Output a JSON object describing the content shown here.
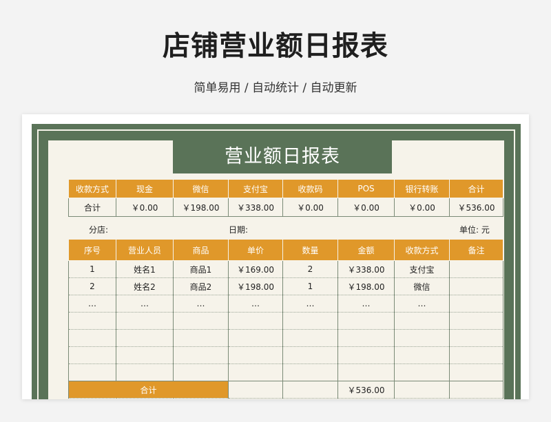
{
  "page": {
    "title": "店铺营业额日报表",
    "subtitle": "简单易用 / 自动统计 / 自动更新"
  },
  "sheet": {
    "title": "营业额日报表",
    "summary": {
      "headers": [
        "收款方式",
        "现金",
        "微信",
        "支付宝",
        "收款码",
        "POS",
        "银行转账",
        "合计"
      ],
      "row": [
        "合计",
        "￥0.00",
        "￥198.00",
        "￥338.00",
        "￥0.00",
        "￥0.00",
        "￥0.00",
        "￥536.00"
      ]
    },
    "meta": {
      "store_label": "分店:",
      "date_label": "日期:",
      "unit_label": "单位: 元"
    },
    "detail": {
      "headers": [
        "序号",
        "营业人员",
        "商品",
        "单价",
        "数量",
        "金额",
        "收款方式",
        "备注"
      ],
      "rows": [
        [
          "1",
          "姓名1",
          "商品1",
          "￥169.00",
          "2",
          "￥338.00",
          "支付宝",
          ""
        ],
        [
          "2",
          "姓名2",
          "商品2",
          "￥198.00",
          "1",
          "￥198.00",
          "微信",
          ""
        ],
        [
          "…",
          "…",
          "…",
          "…",
          "…",
          "…",
          "…",
          ""
        ],
        [
          "",
          "",
          "",
          "",
          "",
          "",
          "",
          ""
        ],
        [
          "",
          "",
          "",
          "",
          "",
          "",
          "",
          ""
        ],
        [
          "",
          "",
          "",
          "",
          "",
          "",
          "",
          ""
        ],
        [
          "",
          "",
          "",
          "",
          "",
          "",
          "",
          ""
        ]
      ],
      "total_label": "合计",
      "total_amount": "￥536.00"
    }
  },
  "colors": {
    "accent_orange": "#e0982a",
    "frame_green": "#5a7358",
    "sheet_bg": "#f6f3ea"
  }
}
